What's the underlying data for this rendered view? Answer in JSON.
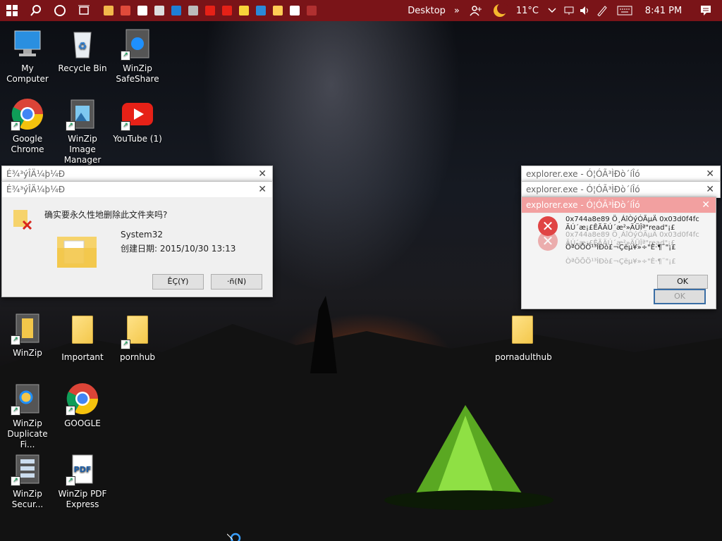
{
  "taskbar": {
    "desktop_label": "Desktop",
    "chevron": "»",
    "temperature": "11°C",
    "time": "8:41 PM",
    "apps": [
      {
        "name": "file-explorer-icon",
        "color": "#f2b84b"
      },
      {
        "name": "chrome-icon",
        "color": "#e04a3a"
      },
      {
        "name": "store-icon",
        "color": "#ffffff"
      },
      {
        "name": "roblox-icon",
        "color": "#dddddd"
      },
      {
        "name": "monitor-icon",
        "color": "#1e7fd6"
      },
      {
        "name": "photos-icon",
        "color": "#bbbbbb"
      },
      {
        "name": "youtube-icon",
        "color": "#e62117"
      },
      {
        "name": "youtube-icon-2",
        "color": "#e62117"
      },
      {
        "name": "sticky-notes-icon",
        "color": "#f7d43a"
      },
      {
        "name": "edge-icon",
        "color": "#2b8ad8"
      },
      {
        "name": "photo-viewer-icon",
        "color": "#ffcc55"
      },
      {
        "name": "7zip-icon",
        "color": "#ffffff"
      },
      {
        "name": "game-icon",
        "color": "#b03030"
      }
    ]
  },
  "desktop_icons": [
    {
      "id": "my-computer",
      "label": "My Computer"
    },
    {
      "id": "recycle-bin",
      "label": "Recycle Bin"
    },
    {
      "id": "winzip-safeshare",
      "label": "WinZip SafeShare"
    },
    {
      "id": "google-chrome",
      "label": "Google Chrome"
    },
    {
      "id": "winzip-image-manager",
      "label": "WinZip Image Manager"
    },
    {
      "id": "youtube",
      "label": "YouTube (1)"
    },
    {
      "id": "winzip",
      "label": "WinZip"
    },
    {
      "id": "important",
      "label": "Important"
    },
    {
      "id": "pornhub",
      "label": "pornhub"
    },
    {
      "id": "pornadulthub",
      "label": "pornadulthub"
    },
    {
      "id": "winzip-duplicate",
      "label": "WinZip Duplicate Fi..."
    },
    {
      "id": "google",
      "label": "GOOGLE"
    },
    {
      "id": "winzip-secure",
      "label": "WinZip Secur..."
    },
    {
      "id": "winzip-pdf",
      "label": "WinZip PDF Express"
    }
  ],
  "delete_dialog": {
    "title_back": "É¾³ýÎÄ¼þ¼Ð",
    "title": "É¾³ýÎÄ¼þ¼Ð",
    "question": "确实要永久性地删除此文件夹吗?",
    "folder_name": "System32",
    "created_label": "创建日期: 2015/10/30 13:13",
    "yes_button": "ÊÇ(Y)",
    "no_button": "·ñ(N)"
  },
  "error_dialog": {
    "title_back": "explorer.exe - Ó¦ÓÃ³ÌÐò´íÎó",
    "title_mid": "explorer.exe - Ó¦ÓÃ³ÌÐò´íÎó",
    "title_front": "explorer.exe - Ó¦ÓÃ³ÌÐò´íÎó",
    "message_line1": "0x744a8e89 Ö¸ÁîÒýÓÃµÄ 0x03d0f4fc",
    "message_line2": "ÄÚ´æ¡£ÊÃÄÚ´æ²»ÄÜÎª\"read\"¡£",
    "message_line3": "ÒªÖÕÖ¹³ÌÐò£¬Çëµ¥»÷\"È·¶¨\"¡£",
    "ghost_line1": "0x744a8e89 Ö¸ÁîÒýÓÃµÄ 0x03d0f4fc",
    "ghost_line2": "ÄÚ´æ¡£ÊÃÄÚ´æ²»ÄÜÎª\"read\"¡£",
    "ghost_line3": "ÒªÖÕÖ¹³ÌÐò£¬Çëµ¥»÷\"È·¶¨\"¡£",
    "ok_button": "OK",
    "ok_button_ghost": "OK"
  }
}
